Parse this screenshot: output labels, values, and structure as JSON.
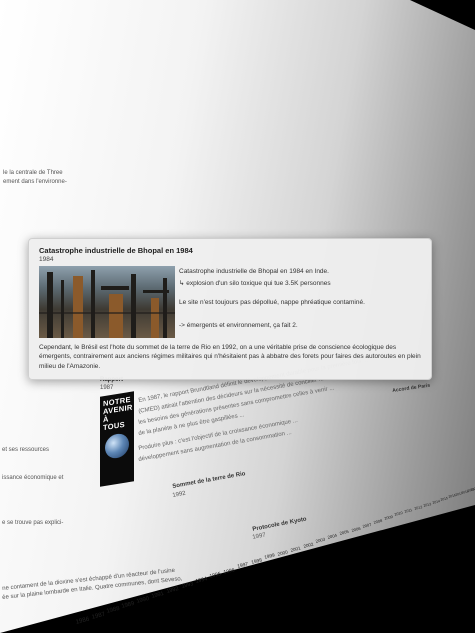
{
  "popup": {
    "title": "Catastrophe industrielle de Bhopal en 1984",
    "year": "1984",
    "detail_lines": [
      "Catastrophe industrielle de Bhopal en 1984 en Inde.",
      "↳ explosion d'un silo toxique qui tue 3.5K personnes",
      "Le site n'est toujours pas dépollué, nappe phréatique contaminé.",
      "-> émergents et environnement, ça fait 2."
    ],
    "paragraph": "Cependant, le Brésil est l'hote du sommet de la terre de Rio en 1992, on a une véritable prise de conscience écologique des émergents, contrairement aux anciens régimes militaires qui n'hésitaient pas à abbatre des forets pour faires des autoroutes en plein milieu de l'Amazonie."
  },
  "background_fragments": {
    "top_left": [
      "le la centrale de Three",
      "ement dans l'environne-"
    ],
    "left_mid": [
      "et ses ressources",
      "issance économique et",
      "e se trouve pas explici-"
    ],
    "bottom_left": [
      "ne contament de la dioxine s'est échappé d'un réacteur de l'usine",
      "ée sur la plaine lombarde en Italie. Quatre communes, dont Seveso,"
    ],
    "back_title": "Rapport",
    "back_year": "1987",
    "book_cover": "NOTRE AVENIR À TOUS",
    "sommet_title": "Sommet de la terre de Rio",
    "sommet_year": "1992",
    "kyoto_title": "Protocole de Kyoto",
    "kyoto_year": "1997",
    "right_title": "Accord de Paris"
  },
  "timeline": {
    "years": [
      "1986",
      "1987",
      "1988",
      "1989",
      "1990",
      "1991",
      "1992",
      "1993",
      "1994",
      "1995",
      "1996",
      "1997",
      "1998",
      "1999",
      "2000",
      "2001",
      "2002",
      "2003",
      "2004",
      "2005",
      "2006",
      "2007",
      "2008",
      "2009",
      "2010",
      "2011",
      "2012",
      "2013",
      "2014",
      "2015",
      "2016",
      "2017",
      "2018",
      "2019",
      "2020"
    ]
  },
  "colors": {
    "backdrop": "#000000",
    "popup_bg": "#eeeeee",
    "book": "#0b0b0b"
  }
}
